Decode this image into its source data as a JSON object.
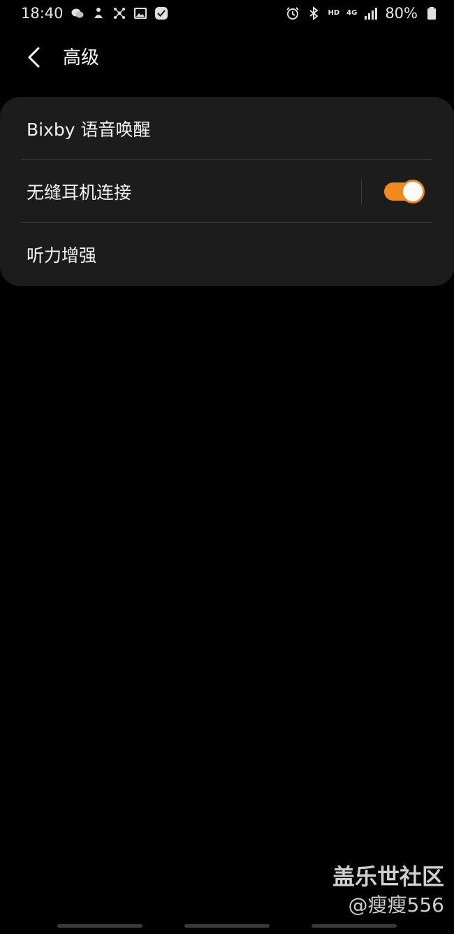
{
  "status_bar": {
    "time": "18:40",
    "network_hd": "HD",
    "network_type": "4G",
    "battery": "80%"
  },
  "header": {
    "title": "高级"
  },
  "settings": {
    "items": [
      {
        "label": "Bixby 语音唤醒"
      },
      {
        "label": "无缝耳机连接",
        "toggle_on": true
      },
      {
        "label": "听力增强"
      }
    ]
  },
  "watermark": {
    "title": "盖乐世社区",
    "user": "@瘦瘦556"
  },
  "colors": {
    "accent": "#f08a1c",
    "card_bg": "#1c1c1c",
    "background": "#000000"
  }
}
